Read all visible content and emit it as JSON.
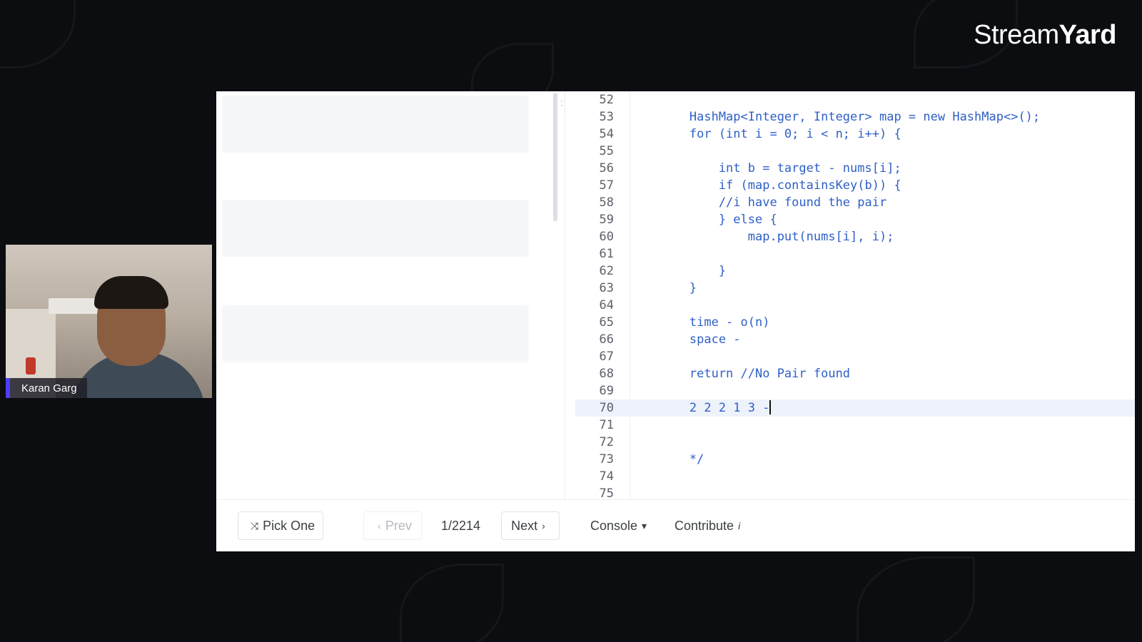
{
  "brand": {
    "light": "Stream",
    "bold": "Yard"
  },
  "participant": {
    "name": "Karan Garg"
  },
  "editor": {
    "lines": [
      {
        "num": "52",
        "text": ""
      },
      {
        "num": "53",
        "text": "        HashMap<Integer, Integer> map = new HashMap<>();"
      },
      {
        "num": "54",
        "text": "        for (int i = 0; i < n; i++) {"
      },
      {
        "num": "55",
        "text": ""
      },
      {
        "num": "56",
        "text": "            int b = target - nums[i];"
      },
      {
        "num": "57",
        "text": "            if (map.containsKey(b)) {"
      },
      {
        "num": "58",
        "text": "            //i have found the pair"
      },
      {
        "num": "59",
        "text": "            } else {"
      },
      {
        "num": "60",
        "text": "                map.put(nums[i], i);"
      },
      {
        "num": "61",
        "text": ""
      },
      {
        "num": "62",
        "text": "            }"
      },
      {
        "num": "63",
        "text": "        }"
      },
      {
        "num": "64",
        "text": ""
      },
      {
        "num": "65",
        "text": "        time - o(n)"
      },
      {
        "num": "66",
        "text": "        space -"
      },
      {
        "num": "67",
        "text": ""
      },
      {
        "num": "68",
        "text": "        return //No Pair found"
      },
      {
        "num": "69",
        "text": ""
      },
      {
        "num": "70",
        "text": "        2 2 2 1 3 -"
      },
      {
        "num": "71",
        "text": ""
      },
      {
        "num": "72",
        "text": ""
      },
      {
        "num": "73",
        "text": "        */"
      },
      {
        "num": "74",
        "text": ""
      },
      {
        "num": "75",
        "text": ""
      }
    ],
    "active_line": "70"
  },
  "toolbar": {
    "pick_one": "Pick One",
    "prev": "Prev",
    "page": "1/2214",
    "next": "Next",
    "console": "Console",
    "contribute": "Contribute",
    "pick_icon": "shuffle-icon",
    "prev_icon": "chevron-left-icon",
    "next_icon": "chevron-right-icon",
    "console_icon": "caret-down-icon",
    "contribute_icon": "info-icon"
  },
  "colors": {
    "code_text": "#2f5fc7",
    "background": "#0c0d11",
    "name_tag_accent": "#4b3dff"
  }
}
